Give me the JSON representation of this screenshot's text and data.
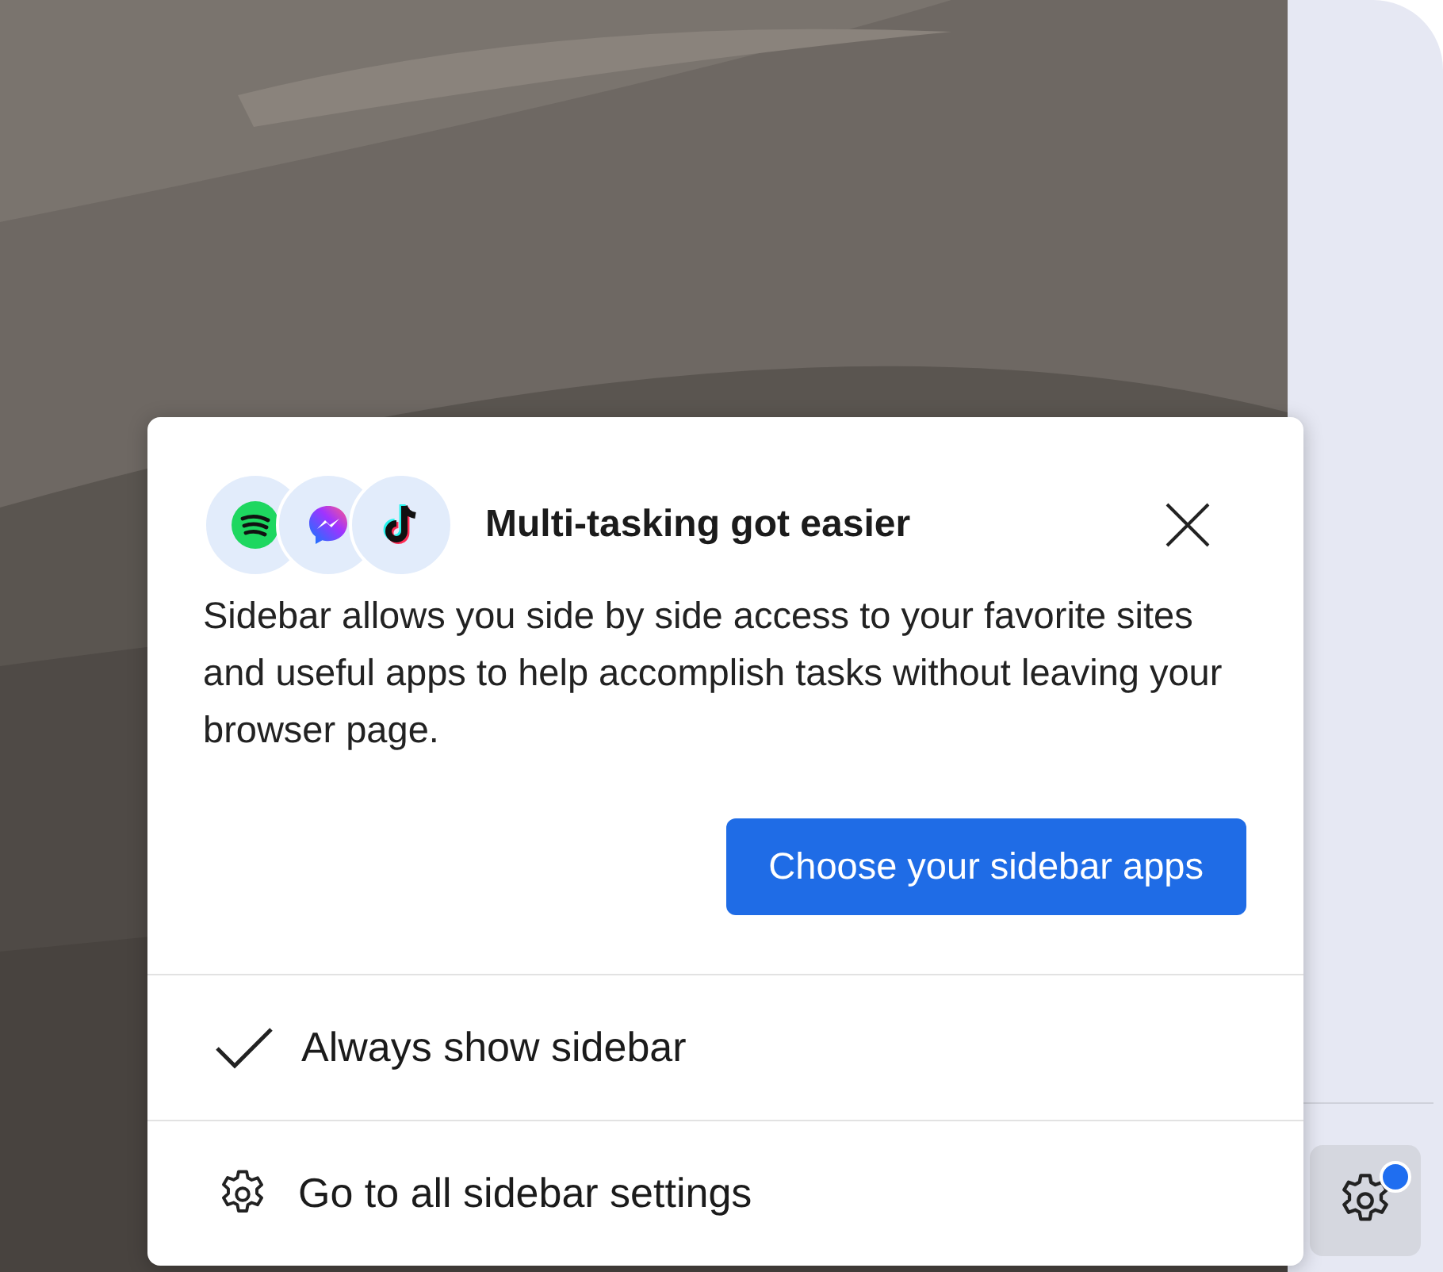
{
  "popup": {
    "title": "Multi-tasking got easier",
    "body": "Sidebar allows you side by side access to your favorite sites and useful apps to help accomplish tasks without leaving your browser page.",
    "primary_button": "Choose your sidebar apps",
    "menu": [
      {
        "kind": "check",
        "label": "Always show sidebar",
        "checked": true
      },
      {
        "kind": "settings",
        "label": "Go to all sidebar settings"
      }
    ]
  },
  "sidebar": {
    "settings_button": {
      "notification": true
    }
  }
}
